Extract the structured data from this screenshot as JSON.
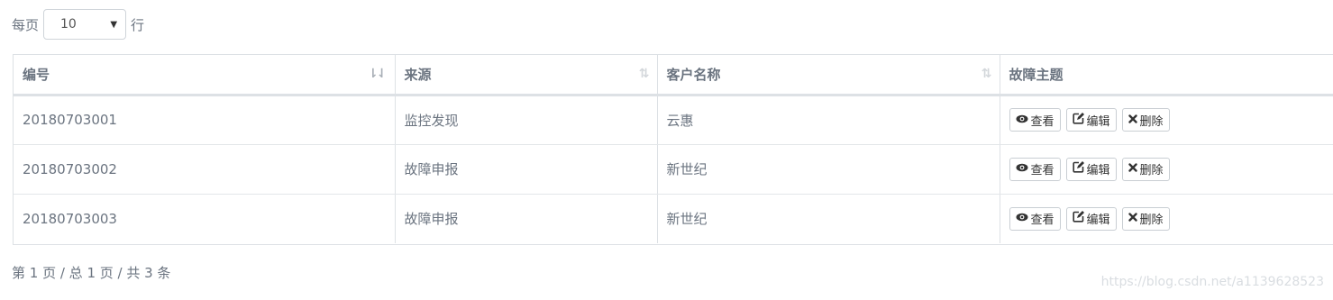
{
  "page_size": {
    "prefix": "每页",
    "value": "10",
    "suffix": "行"
  },
  "table": {
    "headers": {
      "id": "编号",
      "source": "来源",
      "customer": "客户名称",
      "topic": "故障主题"
    },
    "actions": {
      "view": "查看",
      "edit": "编辑",
      "delete": "删除"
    },
    "rows": [
      {
        "id": "20180703001",
        "source": "监控发现",
        "customer": "云惠"
      },
      {
        "id": "20180703002",
        "source": "故障申报",
        "customer": "新世纪"
      },
      {
        "id": "20180703003",
        "source": "故障申报",
        "customer": "新世纪"
      }
    ]
  },
  "pager": {
    "text": "第 1 页 / 总 1 页 / 共 3 条"
  },
  "watermark": "https://blog.csdn.net/a1139628523"
}
